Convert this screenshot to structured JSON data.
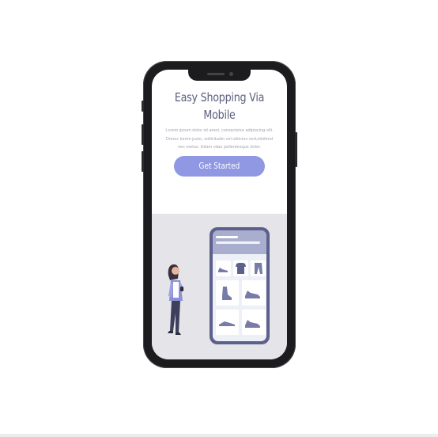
{
  "hero": {
    "title": "Easy Shopping Via Mobile",
    "description": "Lorem ipsum dolor sit amet, consectetur adipiscing elit. Donec lorem justo, sollicitudin vel ultricies sed,eleifend nec metus. Etiam vitae pellentesque dolor.",
    "cta_label": "Get Started"
  },
  "illustration": {
    "subject": "woman shopping with phone next to large phone showing product grid",
    "products": [
      "shoe-icon",
      "shirt-icon",
      "pants-icon",
      "boot-icon",
      "sneaker-icon",
      "flat-shoe-icon",
      "sneaker-icon"
    ]
  },
  "colors": {
    "accent": "#9097e3",
    "title": "#595f7e",
    "body_text": "#a3a6b6",
    "illustration_bg": "#e4e4e9",
    "phone_frame": "#1c1c1e"
  }
}
